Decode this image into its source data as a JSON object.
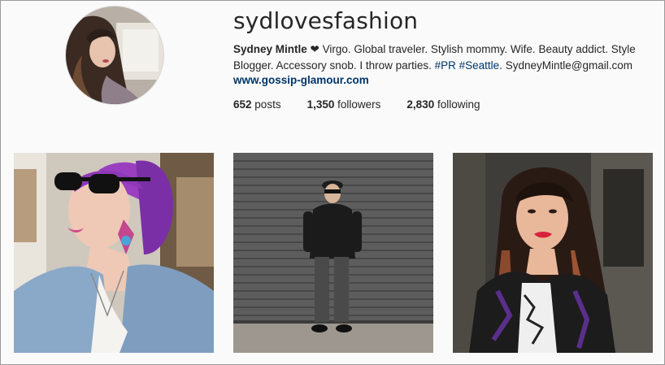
{
  "profile": {
    "username": "sydlovesfashion",
    "full_name": "Sydney Mintle",
    "heart": "❤",
    "bio_text": " Virgo. Global traveler. Stylish mommy. Wife. Beauty addict. Style Blogger. Accessory snob. I throw parties. ",
    "tag_pr": "#PR",
    "tag_seattle": "#Seattle",
    "email": ". SydneyMintle@gmail.com",
    "website": "www.gossip-glamour.com"
  },
  "stats": {
    "posts_count": "652",
    "posts_label": "posts",
    "followers_count": "1,350",
    "followers_label": "followers",
    "following_count": "2,830",
    "following_label": "following"
  },
  "colors": {
    "link": "#003569",
    "text": "#262626",
    "background": "#fafafa"
  }
}
